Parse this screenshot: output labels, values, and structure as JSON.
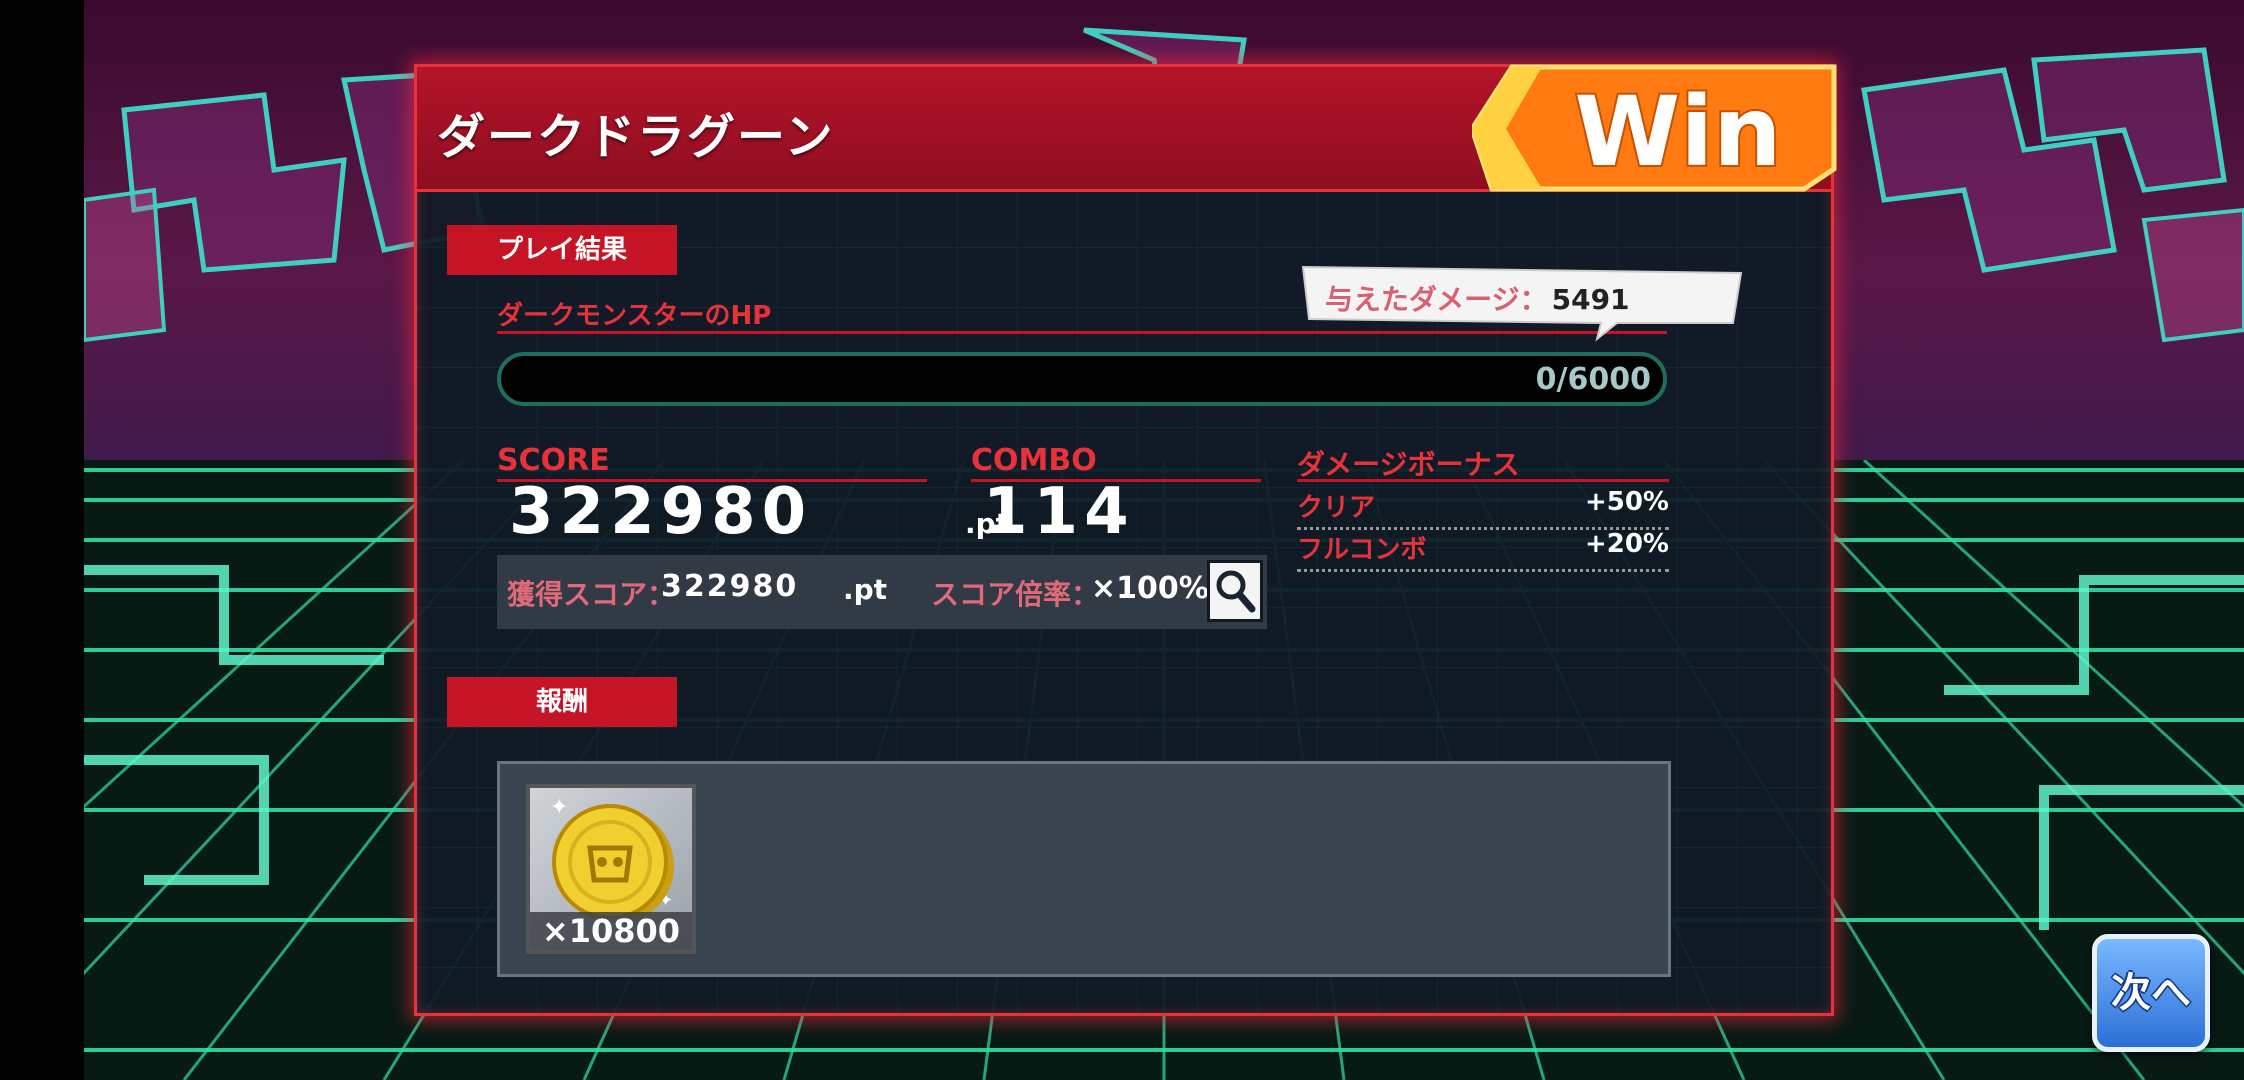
{
  "panel": {
    "title": "ダークドラグーン",
    "result_badge": "Win",
    "sections": {
      "play_result": "プレイ結果",
      "reward": "報酬"
    }
  },
  "hp": {
    "label": "ダークモンスターのHP",
    "damage_label": "与えたダメージ：",
    "damage_value": "5491",
    "current": 0,
    "max": 6000,
    "text": "0/6000"
  },
  "score": {
    "label": "SCORE",
    "value": "322980",
    "unit": ".pt",
    "earned_label": "獲得スコア：",
    "earned_value": "322980",
    "earned_unit": ".pt",
    "multiplier_label": "スコア倍率：",
    "multiplier_value": "×100%"
  },
  "combo": {
    "label": "COMBO",
    "value": "114"
  },
  "damage_bonus": {
    "label": "ダメージボーナス",
    "rows": [
      {
        "name": "クリア",
        "value": "+50%"
      },
      {
        "name": "フルコンボ",
        "value": "+20%"
      }
    ]
  },
  "rewards": [
    {
      "icon": "gold-coin-icon",
      "quantity": "×10800"
    }
  ],
  "next_button": "次へ",
  "icons": {
    "zoom": "magnifier-icon"
  },
  "colors": {
    "accent_red": "#c41426",
    "neon_green": "#2fd4b0",
    "next_blue": "#2b6fd6"
  }
}
